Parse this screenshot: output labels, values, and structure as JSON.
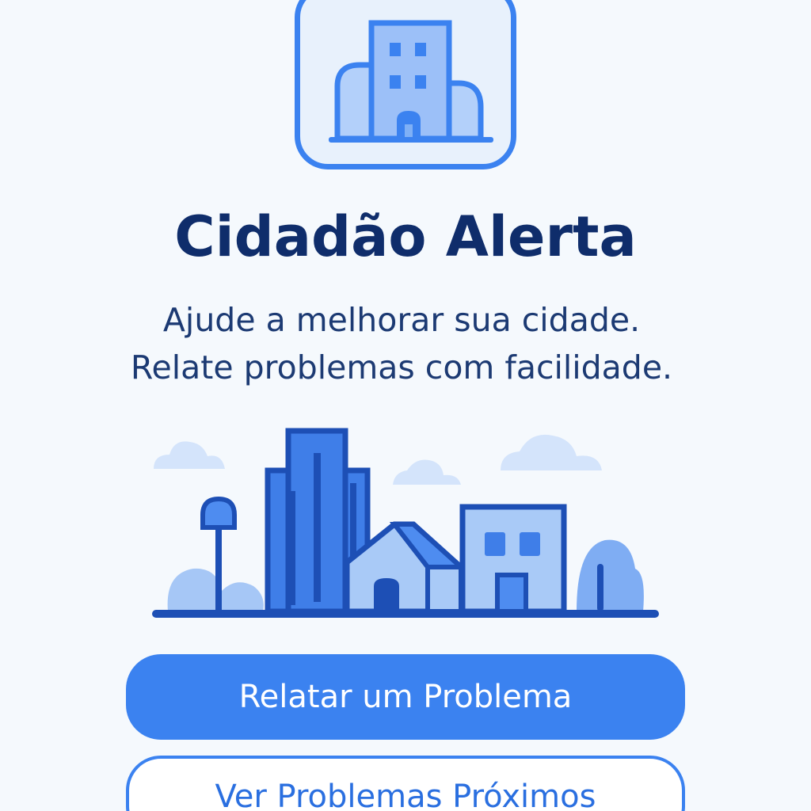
{
  "app": {
    "title": "Cidadão Alerta",
    "subtitle_line1": "Ajude a melhorar sua cidade.",
    "subtitle_line2": "Relate problemas com facilidade."
  },
  "actions": {
    "primary_label": "Relatar um Problema",
    "secondary_label": "Ver Problemas Próximos"
  },
  "icons": {
    "logo": "building-icon",
    "illustration": "city-skyline-illustration"
  },
  "colors": {
    "background": "#f5f9fd",
    "primary": "#3b82f0",
    "title": "#0f2d6b",
    "text": "#1c3a73"
  }
}
